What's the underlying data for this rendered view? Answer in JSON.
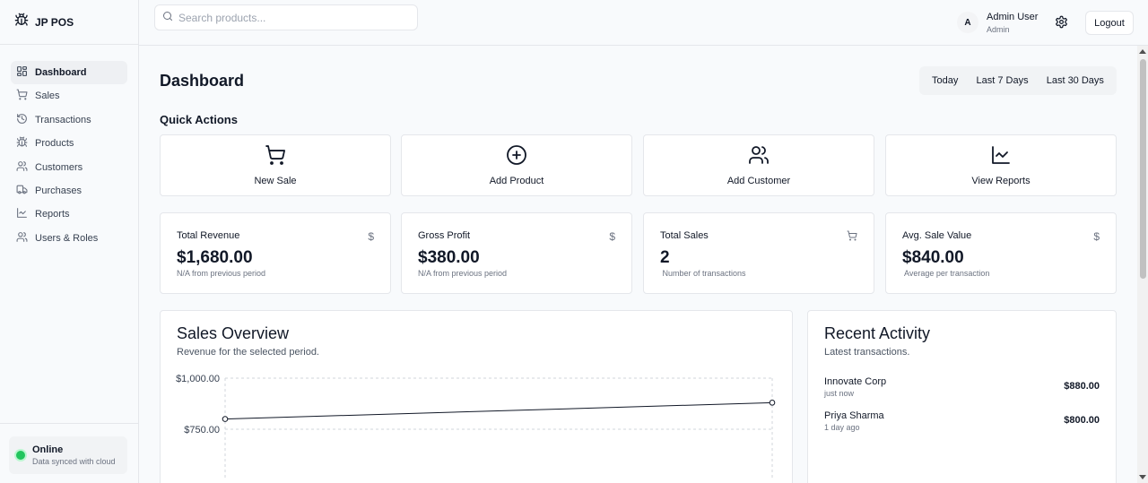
{
  "app": {
    "name": "JP POS"
  },
  "sidebar": {
    "items": [
      {
        "label": "Dashboard",
        "icon": "dashboard-icon",
        "active": true
      },
      {
        "label": "Sales",
        "icon": "cart-icon"
      },
      {
        "label": "Transactions",
        "icon": "history-icon"
      },
      {
        "label": "Products",
        "icon": "bug-icon"
      },
      {
        "label": "Customers",
        "icon": "users-icon"
      },
      {
        "label": "Purchases",
        "icon": "truck-icon"
      },
      {
        "label": "Reports",
        "icon": "line-chart-icon"
      },
      {
        "label": "Users & Roles",
        "icon": "user-roles-icon"
      }
    ],
    "status": {
      "title": "Online",
      "subtitle": "Data synced with cloud",
      "color": "#22c55e"
    }
  },
  "header": {
    "search_placeholder": "Search products...",
    "avatar_initial": "A",
    "user_name": "Admin User",
    "user_role": "Admin",
    "logout_label": "Logout"
  },
  "page": {
    "title": "Dashboard",
    "ranges": [
      "Today",
      "Last 7 Days",
      "Last 30 Days"
    ]
  },
  "quick_actions": {
    "title": "Quick Actions",
    "items": [
      {
        "label": "New Sale",
        "icon": "cart-icon"
      },
      {
        "label": "Add Product",
        "icon": "plus-circle-icon"
      },
      {
        "label": "Add Customer",
        "icon": "users-icon"
      },
      {
        "label": "View Reports",
        "icon": "line-chart-icon"
      }
    ]
  },
  "stats": [
    {
      "label": "Total Revenue",
      "value": "$1,680.00",
      "sub": "N/A from previous period",
      "icon": "dollar-icon"
    },
    {
      "label": "Gross Profit",
      "value": "$380.00",
      "sub": "N/A from previous period",
      "icon": "dollar-icon"
    },
    {
      "label": "Total Sales",
      "value": "2",
      "sub": " Number of transactions",
      "icon": "cart-icon"
    },
    {
      "label": "Avg. Sale Value",
      "value": "$840.00",
      "sub": " Average per transaction",
      "icon": "dollar-icon"
    }
  ],
  "sales_overview": {
    "title": "Sales Overview",
    "subtitle": "Revenue for the selected period."
  },
  "chart_data": {
    "type": "line",
    "title": "",
    "xlabel": "",
    "ylabel": "",
    "ylim": [
      500,
      1000
    ],
    "yticks": [
      "$1,000.00",
      "$750.00"
    ],
    "ytick_values": [
      1000,
      750
    ],
    "grid": true,
    "series": [
      {
        "values": [
          800,
          880
        ]
      }
    ],
    "line_color": "#111827"
  },
  "recent_activity": {
    "title": "Recent Activity",
    "subtitle": "Latest transactions.",
    "items": [
      {
        "name": "Innovate Corp",
        "time": "just now",
        "amount": "$880.00"
      },
      {
        "name": "Priya Sharma",
        "time": "1 day ago",
        "amount": "$800.00"
      }
    ]
  }
}
